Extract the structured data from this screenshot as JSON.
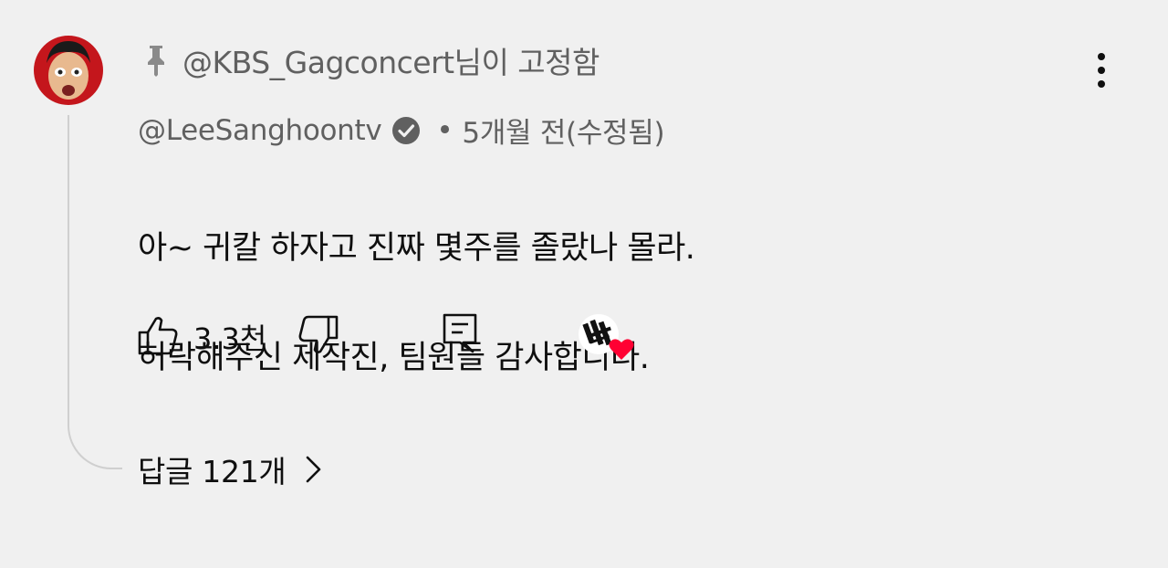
{
  "comment": {
    "pinned_label": "@KBS_Gagconcert님이 고정함",
    "author": "@LeeSanghoontv",
    "separator": "•",
    "timestamp": "5개월 전(수정됨)",
    "line1": "아~ 귀칼 하자고 진짜 몇주를 졸랐나 몰라.",
    "line2": "허락해주신 제작진, 팀원들 감사합니다."
  },
  "actions": {
    "like_count": "3.3천"
  },
  "replies": {
    "label": "답글 121개"
  },
  "icons": {
    "pin": "pin-icon",
    "verified": "verified-check-icon",
    "more": "more-vertical-icon",
    "like": "thumbs-up-icon",
    "dislike": "thumbs-down-icon",
    "reply": "comment-reply-icon",
    "heart": "creator-heart-icon",
    "chevron": "chevron-right-icon"
  },
  "colors": {
    "background": "#f0f0f0",
    "text_primary": "#0f0f0f",
    "text_secondary": "#606060",
    "heart": "#ff0033"
  }
}
